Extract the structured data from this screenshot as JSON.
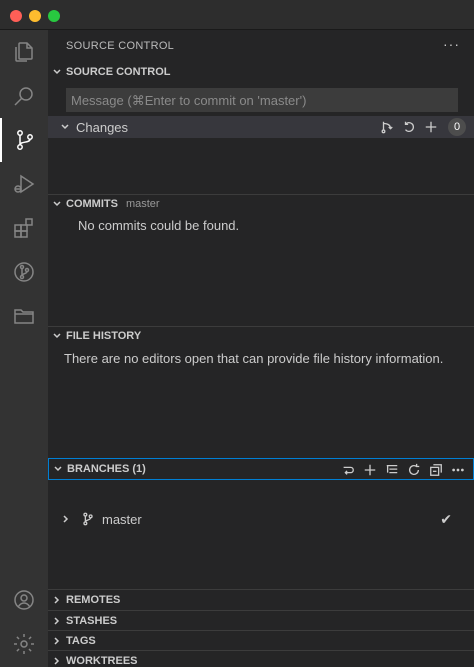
{
  "sidebar": {
    "title": "SOURCE CONTROL",
    "more": "···"
  },
  "source_control": {
    "header": "SOURCE CONTROL",
    "message_placeholder": "Message (⌘Enter to commit on 'master')",
    "changes": {
      "label": "Changes",
      "count": "0"
    }
  },
  "commits": {
    "header": "COMMITS",
    "branch": "master",
    "empty": "No commits could be found."
  },
  "file_history": {
    "header": "FILE HISTORY",
    "empty": "There are no editors open that can provide file history information."
  },
  "branches": {
    "header": "BRANCHES (1)",
    "items": [
      {
        "label": "master",
        "current_mark": "✔"
      }
    ]
  },
  "collapsed_sections": [
    "REMOTES",
    "STASHES",
    "TAGS",
    "WORKTREES"
  ],
  "colors": {
    "accent_border": "#007fd4",
    "sidebar_bg": "#252526",
    "activity_bg": "#333333"
  }
}
